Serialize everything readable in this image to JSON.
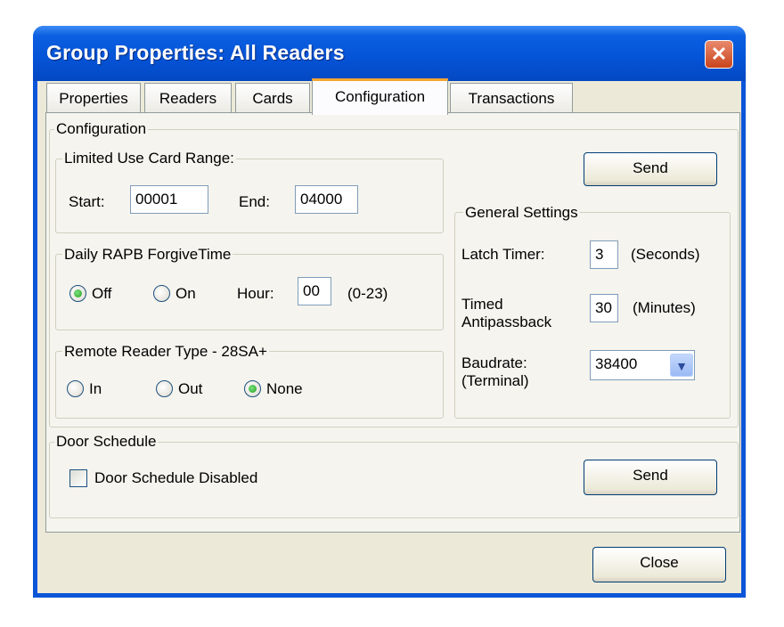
{
  "window": {
    "title": "Group Properties: All Readers",
    "close_glyph": "✕"
  },
  "tabs": [
    {
      "label": "Properties"
    },
    {
      "label": "Readers"
    },
    {
      "label": "Cards"
    },
    {
      "label": "Configuration"
    },
    {
      "label": "Transactions"
    }
  ],
  "active_tab": "Configuration",
  "configuration": {
    "legend": "Configuration",
    "limited_use": {
      "legend": "Limited Use Card Range:",
      "start_label": "Start:",
      "start_value": "00001",
      "end_label": "End:",
      "end_value": "04000"
    },
    "daily_rapb": {
      "legend": "Daily RAPB ForgiveTime",
      "off_label": "Off",
      "on_label": "On",
      "selected": "Off",
      "hour_label": "Hour:",
      "hour_value": "00",
      "hour_range": "(0-23)"
    },
    "remote_reader": {
      "legend": "Remote Reader Type - 28SA+",
      "in_label": "In",
      "out_label": "Out",
      "none_label": "None",
      "selected": "None"
    },
    "send_label": "Send",
    "general": {
      "legend": "General Settings",
      "latch_label": "Latch Timer:",
      "latch_value": "3",
      "latch_unit": "(Seconds)",
      "timed_label_1": "Timed",
      "timed_label_2": "Antipassback",
      "timed_value": "30",
      "timed_unit": "(Minutes)",
      "baud_label_1": "Baudrate:",
      "baud_label_2": "(Terminal)",
      "baud_value": "38400"
    }
  },
  "door_schedule": {
    "legend": "Door Schedule",
    "checkbox_label": "Door Schedule Disabled",
    "checked": false,
    "send_label": "Send"
  },
  "footer": {
    "close_label": "Close"
  }
}
